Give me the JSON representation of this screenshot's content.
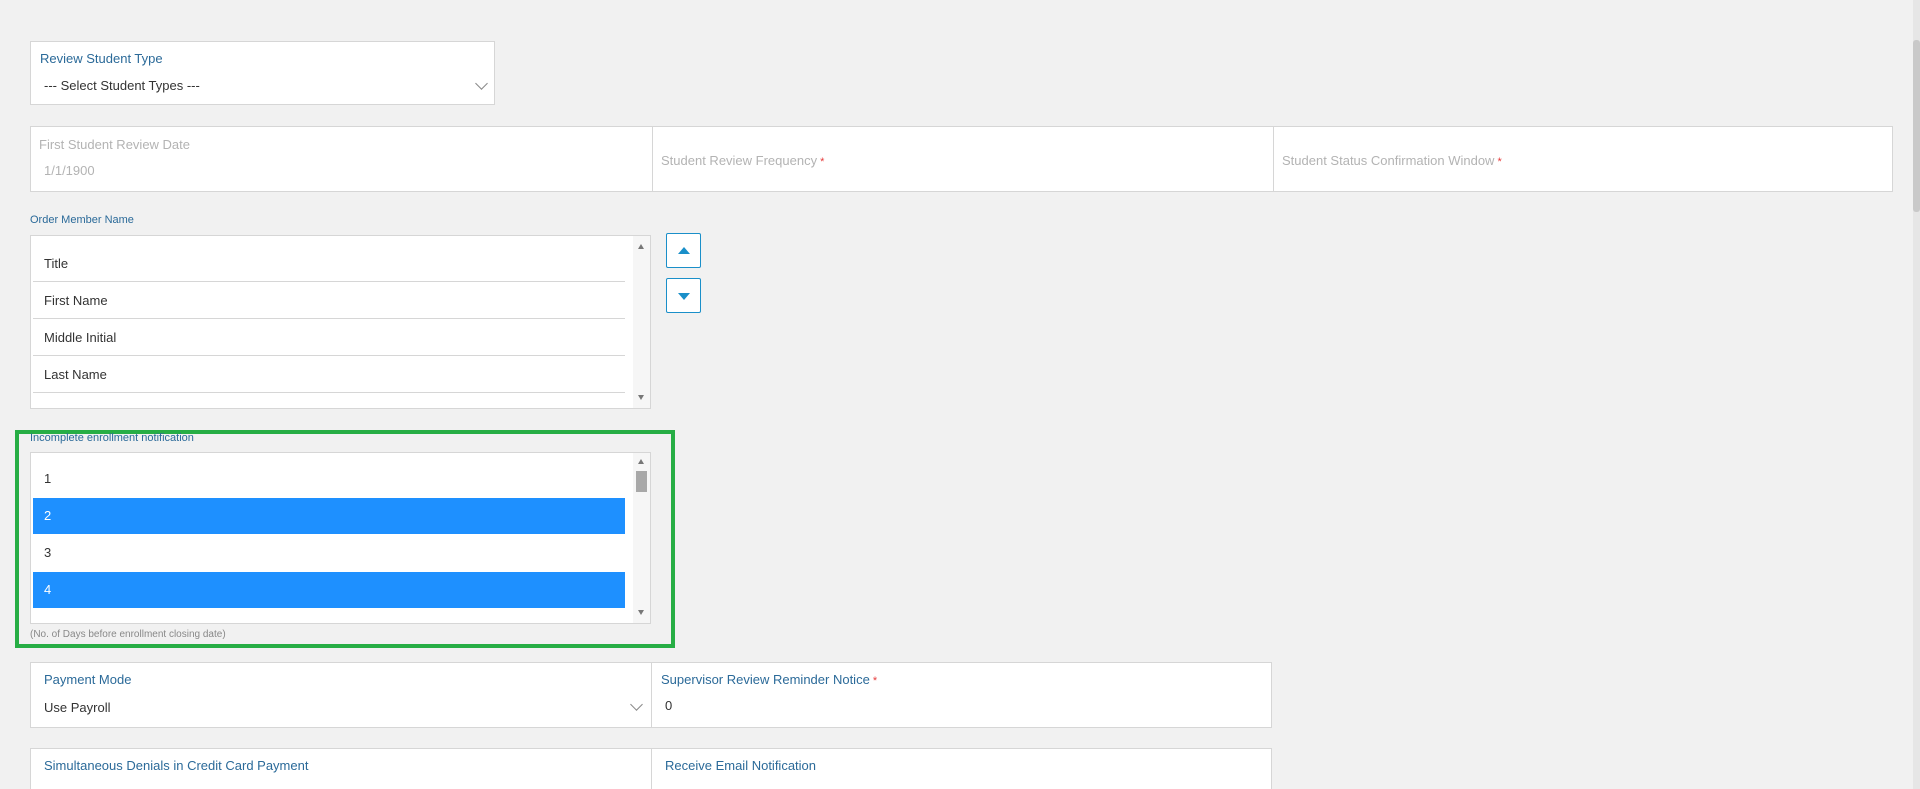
{
  "review_student_type": {
    "label": "Review Student Type",
    "value": "--- Select Student Types ---"
  },
  "review_dates": {
    "first_review_label": "First Student Review Date",
    "first_review_value": "1/1/1900",
    "frequency_label": "Student Review Frequency",
    "confirmation_label": "Student Status Confirmation Window",
    "required_mark": "*"
  },
  "order_member_name": {
    "label": "Order Member Name",
    "items": [
      "Title",
      "First Name",
      "Middle Initial",
      "Last Name"
    ]
  },
  "incomplete_enrollment": {
    "label": "Incomplete enrollment notification",
    "items": [
      "1",
      "2",
      "3",
      "4"
    ],
    "selected": [
      "2",
      "4"
    ],
    "hint": "(No. of Days before enrollment closing date)"
  },
  "payment": {
    "mode_label": "Payment Mode",
    "mode_value": "Use Payroll",
    "reminder_label": "Supervisor Review Reminder Notice",
    "reminder_value": "0",
    "required_mark": "*"
  },
  "notifications": {
    "denials_label": "Simultaneous Denials in Credit Card Payment",
    "email_label": "Receive Email Notification"
  },
  "colors": {
    "label_blue": "#2b6a99",
    "selection": "#1e90ff",
    "highlight": "#27ae45",
    "required": "#e63a3a"
  }
}
